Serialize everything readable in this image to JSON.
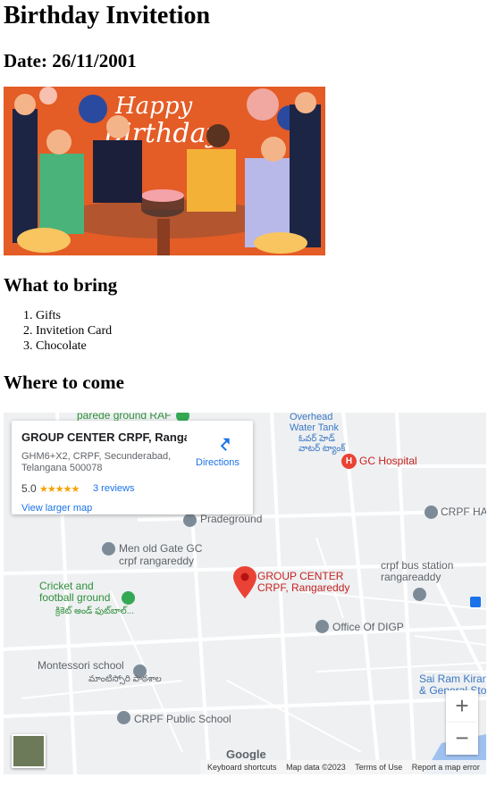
{
  "page": {
    "title": "Birthday Invitetion",
    "date": "Date: 26/11/2001",
    "hero_text": "Happy Birthday"
  },
  "bring": {
    "heading": "What to bring",
    "items": [
      "Gifts",
      "Invitetion Card",
      "Chocolate"
    ]
  },
  "where": {
    "heading": "Where to come"
  },
  "map": {
    "card": {
      "title": "GROUP CENTER CRPF, Rangar...",
      "address": "GHM6+X2, CRPF, Secunderabad, Telangana 500078",
      "rating": "5.0",
      "stars": "★★★★★",
      "reviews": "3 reviews",
      "larger_map": "View larger map",
      "directions": "Directions"
    },
    "labels": {
      "parade_ground": "parede ground RAF",
      "overhead_tank": "Overhead Water Tank",
      "overhead_tank_te": "ఓవర్ హెడ్ వాటర్ ట్యాంక్",
      "gc_hospital": "GC Hospital",
      "crpf_ha": "CRPF HA",
      "prade_ground": "Pradeground",
      "men_old_gate": "Men old Gate GC crpf rangareddy",
      "group_center_pin": "GROUP CENTER CRPF, Rangareddy",
      "crpf_bus_station": "crpf bus station rangareaddy",
      "cricket_ground": "Cricket and football ground",
      "cricket_ground_te": "క్రికెట్ అండ్ ఫుట్‌బాల్...",
      "office_digp": "Office Of DIGP",
      "montessori": "Montessori school",
      "montessori_te": "మాంటిస్సోరి పాఠశాల",
      "sai_ram": "Sai Ram Kiran & General Sto",
      "crpf_public_school": "CRPF Public School"
    },
    "zoom_in": "+",
    "zoom_out": "−",
    "google": "Google",
    "footer": {
      "shortcuts": "Keyboard shortcuts",
      "map_data": "Map data ©2023",
      "terms": "Terms of Use",
      "report": "Report a map error"
    },
    "colors": {
      "accent": "#1a73e8",
      "pin": "#ea4335",
      "star": "#f6a200"
    }
  }
}
